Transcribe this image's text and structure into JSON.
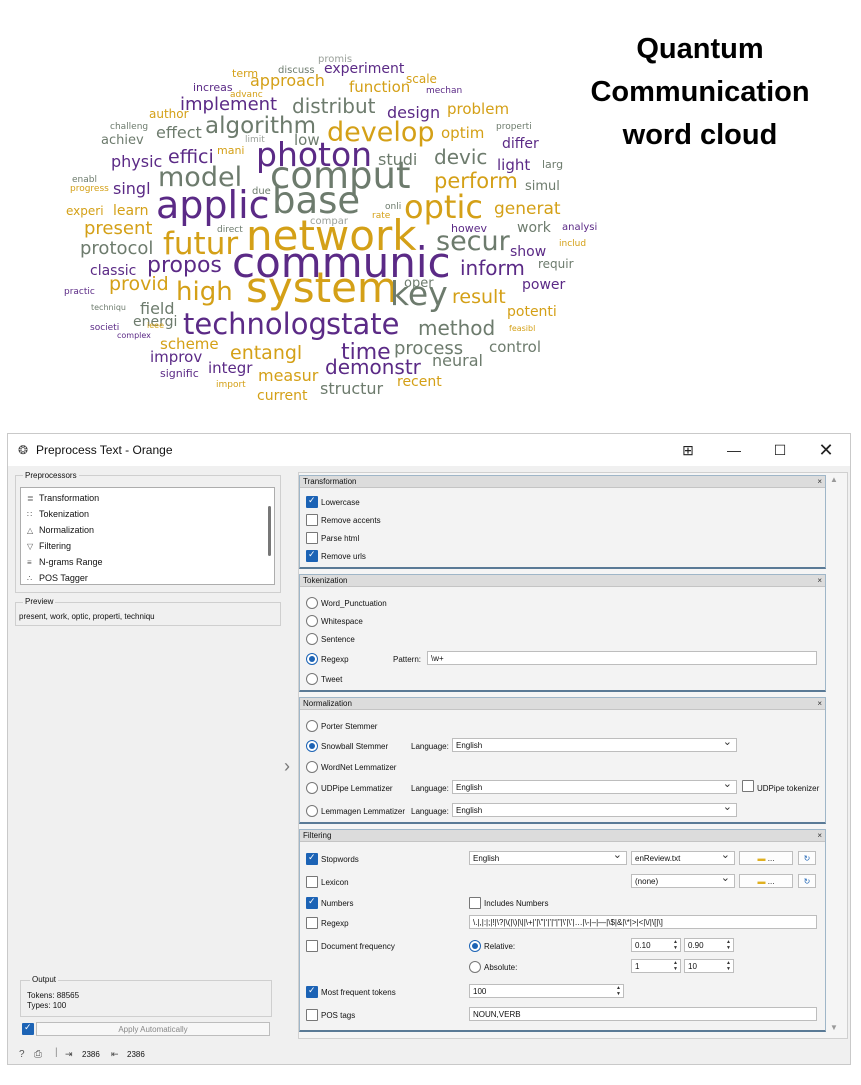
{
  "wordcloud": {
    "title_lines": [
      "Quantum",
      "Communication",
      "word cloud"
    ],
    "colors": {
      "purple": "#5b2a86",
      "gold": "#d4a017",
      "gray": "#6d7b6d"
    },
    "words": [
      {
        "t": "promis",
        "c": "#9aa09a"
      },
      {
        "t": "experiment",
        "c": "#5b2a86"
      },
      {
        "t": "discuss",
        "c": "#6d7b6d"
      },
      {
        "t": "term",
        "c": "#d4a017"
      },
      {
        "t": "approach",
        "c": "#d4a017"
      },
      {
        "t": "function",
        "c": "#d4a017"
      },
      {
        "t": "scale",
        "c": "#d4a017"
      },
      {
        "t": "increas",
        "c": "#5b2a86"
      },
      {
        "t": "advanc",
        "c": "#d4a017"
      },
      {
        "t": "mechan",
        "c": "#5b2a86"
      },
      {
        "t": "implement",
        "c": "#5b2a86"
      },
      {
        "t": "distribut",
        "c": "#6d7b6d"
      },
      {
        "t": "design",
        "c": "#5b2a86"
      },
      {
        "t": "problem",
        "c": "#d4a017"
      },
      {
        "t": "author",
        "c": "#d4a017"
      },
      {
        "t": "algorithm",
        "c": "#6d7b6d"
      },
      {
        "t": "challeng",
        "c": "#6d7b6d"
      },
      {
        "t": "effect",
        "c": "#6d7b6d"
      },
      {
        "t": "limit",
        "c": "#9aa09a"
      },
      {
        "t": "low",
        "c": "#6d7b6d"
      },
      {
        "t": "develop",
        "c": "#d4a017"
      },
      {
        "t": "optim",
        "c": "#d4a017"
      },
      {
        "t": "properti",
        "c": "#6d7b6d"
      },
      {
        "t": "achiev",
        "c": "#6d7b6d"
      },
      {
        "t": "differ",
        "c": "#5b2a86"
      },
      {
        "t": "photon",
        "c": "#5b2a86"
      },
      {
        "t": "mani",
        "c": "#d4a017"
      },
      {
        "t": "effici",
        "c": "#5b2a86"
      },
      {
        "t": "physic",
        "c": "#5b2a86"
      },
      {
        "t": "studi",
        "c": "#6d7b6d"
      },
      {
        "t": "devic",
        "c": "#6d7b6d"
      },
      {
        "t": "light",
        "c": "#5b2a86"
      },
      {
        "t": "larg",
        "c": "#6d7b6d"
      },
      {
        "t": "model",
        "c": "#6d7b6d"
      },
      {
        "t": "comput",
        "c": "#6d7b6d"
      },
      {
        "t": "enabl",
        "c": "#6d7b6d"
      },
      {
        "t": "perform",
        "c": "#d4a017"
      },
      {
        "t": "progress",
        "c": "#d4a017"
      },
      {
        "t": "singl",
        "c": "#5b2a86"
      },
      {
        "t": "due",
        "c": "#6d7b6d"
      },
      {
        "t": "simul",
        "c": "#6d7b6d"
      },
      {
        "t": "base",
        "c": "#6d7b6d"
      },
      {
        "t": "applic",
        "c": "#5b2a86"
      },
      {
        "t": "experi",
        "c": "#d4a017"
      },
      {
        "t": "learn",
        "c": "#d4a017"
      },
      {
        "t": "onli",
        "c": "#6d7b6d"
      },
      {
        "t": "optic",
        "c": "#d4a017"
      },
      {
        "t": "generat",
        "c": "#d4a017"
      },
      {
        "t": "compar",
        "c": "#9aa09a"
      },
      {
        "t": "rate",
        "c": "#d4a017"
      },
      {
        "t": "present",
        "c": "#d4a017"
      },
      {
        "t": "direct",
        "c": "#6d7b6d"
      },
      {
        "t": "howev",
        "c": "#5b2a86"
      },
      {
        "t": "work",
        "c": "#6d7b6d"
      },
      {
        "t": "analysi",
        "c": "#5b2a86"
      },
      {
        "t": "network",
        "c": "#d4a017"
      },
      {
        "t": "protocol",
        "c": "#6d7b6d"
      },
      {
        "t": "futur",
        "c": "#d4a017"
      },
      {
        "t": "secur",
        "c": "#6d7b6d"
      },
      {
        "t": "show",
        "c": "#5b2a86"
      },
      {
        "t": "includ",
        "c": "#d4a017"
      },
      {
        "t": "classic",
        "c": "#5b2a86"
      },
      {
        "t": "propos",
        "c": "#5b2a86"
      },
      {
        "t": "communic",
        "c": "#5b2a86"
      },
      {
        "t": "inform",
        "c": "#5b2a86"
      },
      {
        "t": "requir",
        "c": "#6d7b6d"
      },
      {
        "t": "provid",
        "c": "#d4a017"
      },
      {
        "t": "oper",
        "c": "#6d7b6d"
      },
      {
        "t": "power",
        "c": "#5b2a86"
      },
      {
        "t": "practic",
        "c": "#5b2a86"
      },
      {
        "t": "high",
        "c": "#d4a017"
      },
      {
        "t": "system",
        "c": "#d4a017"
      },
      {
        "t": "key",
        "c": "#6d7b6d"
      },
      {
        "t": "result",
        "c": "#d4a017"
      },
      {
        "t": "techniqu",
        "c": "#6d7b6d"
      },
      {
        "t": "field",
        "c": "#6d7b6d"
      },
      {
        "t": "potenti",
        "c": "#d4a017"
      },
      {
        "t": "societi",
        "c": "#5b2a86"
      },
      {
        "t": "energi",
        "c": "#6d7b6d"
      },
      {
        "t": "feasibl",
        "c": "#d4a017"
      },
      {
        "t": "ieee",
        "c": "#d4a017"
      },
      {
        "t": "technolog",
        "c": "#5b2a86"
      },
      {
        "t": "state",
        "c": "#5b2a86"
      },
      {
        "t": "method",
        "c": "#6d7b6d"
      },
      {
        "t": "complex",
        "c": "#5b2a86"
      },
      {
        "t": "scheme",
        "c": "#d4a017"
      },
      {
        "t": "process",
        "c": "#6d7b6d"
      },
      {
        "t": "control",
        "c": "#6d7b6d"
      },
      {
        "t": "entangl",
        "c": "#d4a017"
      },
      {
        "t": "time",
        "c": "#5b2a86"
      },
      {
        "t": "improv",
        "c": "#5b2a86"
      },
      {
        "t": "neural",
        "c": "#6d7b6d"
      },
      {
        "t": "integr",
        "c": "#5b2a86"
      },
      {
        "t": "demonstr",
        "c": "#5b2a86"
      },
      {
        "t": "signific",
        "c": "#5b2a86"
      },
      {
        "t": "measur",
        "c": "#d4a017"
      },
      {
        "t": "recent",
        "c": "#d4a017"
      },
      {
        "t": "import",
        "c": "#d4a017"
      },
      {
        "t": "structur",
        "c": "#6d7b6d"
      },
      {
        "t": "current",
        "c": "#d4a017"
      }
    ]
  },
  "window": {
    "title": "Preprocess Text - Orange",
    "app_icon": "orange-widget-icon"
  },
  "preprocessors": {
    "label": "Preprocessors",
    "items": [
      {
        "label": "Transformation",
        "icon": "transformation-icon",
        "glyph": "≣"
      },
      {
        "label": "Tokenization",
        "icon": "tokenization-icon",
        "glyph": "∷"
      },
      {
        "label": "Normalization",
        "icon": "normalization-icon",
        "glyph": "△"
      },
      {
        "label": "Filtering",
        "icon": "filter-icon",
        "glyph": "▽"
      },
      {
        "label": "N-grams Range",
        "icon": "ngrams-icon",
        "glyph": "≡"
      },
      {
        "label": "POS Tagger",
        "icon": "pos-tagger-icon",
        "glyph": "∴"
      }
    ]
  },
  "preview": {
    "label": "Preview",
    "text": "present, work, optic, properti, techniqu"
  },
  "output": {
    "label": "Output",
    "tokens": "Tokens: 88565",
    "types": "Types: 100"
  },
  "apply": {
    "checked": true,
    "label": "Apply Automatically"
  },
  "statusbar": {
    "input_count": "2386",
    "output_count": "2386"
  },
  "transformation": {
    "title": "Transformation",
    "options": [
      {
        "label": "Lowercase",
        "checked": true
      },
      {
        "label": "Remove accents",
        "checked": false
      },
      {
        "label": "Parse html",
        "checked": false
      },
      {
        "label": "Remove urls",
        "checked": true
      }
    ]
  },
  "tokenization": {
    "title": "Tokenization",
    "options": [
      "Word_Punctuation",
      "Whitespace",
      "Sentence",
      "Regexp",
      "Tweet"
    ],
    "selected": "Regexp",
    "pattern_label": "Pattern:",
    "pattern": "\\w+"
  },
  "normalization": {
    "title": "Normalization",
    "porter": "Porter Stemmer",
    "snowball": "Snowball Stemmer",
    "wordnet": "WordNet Lemmatizer",
    "udpipe": "UDPipe Lemmatizer",
    "lemmagen": "Lemmagen Lemmatizer",
    "selected": "Snowball Stemmer",
    "language_label": "Language:",
    "snowball_language": "English",
    "udpipe_language": "English",
    "lemmagen_language": "English",
    "udpipe_tokenizer": "UDPipe tokenizer"
  },
  "filtering": {
    "title": "Filtering",
    "stopwords": {
      "label": "Stopwords",
      "checked": true,
      "language": "English",
      "file": "enReview.txt"
    },
    "lexicon": {
      "label": "Lexicon",
      "checked": false,
      "file": "(none)"
    },
    "numbers": {
      "label": "Numbers",
      "checked": true
    },
    "includes_numbers": {
      "label": "Includes Numbers",
      "checked": false
    },
    "regexp": {
      "label": "Regexp",
      "checked": false,
      "value": "\\.|,|:|;|!|\\?|\\(|\\)|\\||\\+|'|\\\"|‘|’|“|”|\\'|\\’|…|\\-|–|—|\\$|&|\\*|>|<|\\/|\\[|\\]"
    },
    "doc_freq": {
      "label": "Document frequency",
      "checked": false
    },
    "relative": {
      "label": "Relative:",
      "selected": true,
      "min": "0.10",
      "max": "0.90"
    },
    "absolute": {
      "label": "Absolute:",
      "selected": false,
      "min": "1",
      "max": "10"
    },
    "most_frequent": {
      "label": "Most frequent tokens",
      "checked": true,
      "value": "100"
    },
    "pos_tags": {
      "label": "POS tags",
      "checked": false,
      "value": "NOUN,VERB"
    },
    "browse_label": "...",
    "close_glyph": "×"
  }
}
